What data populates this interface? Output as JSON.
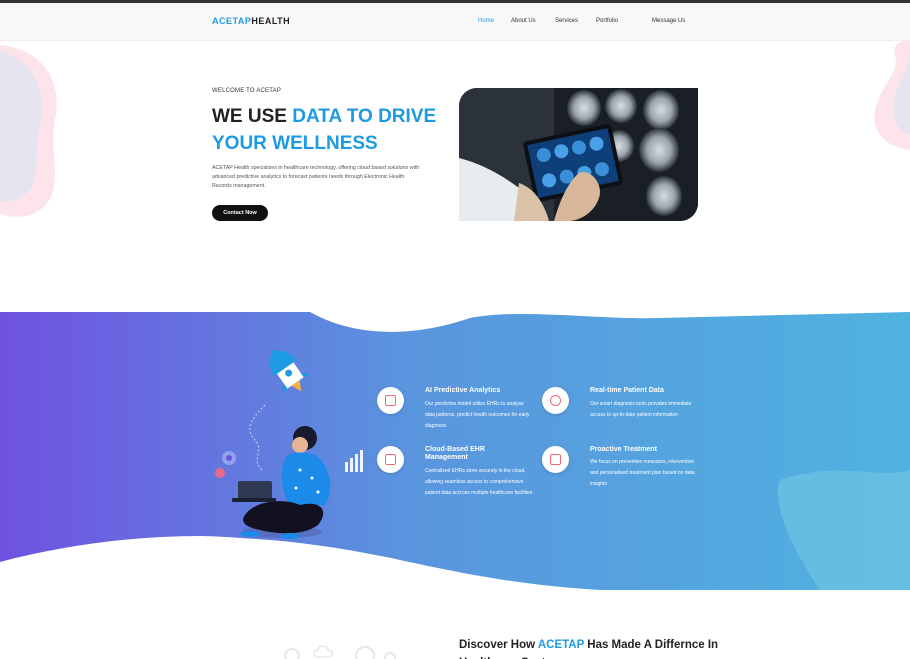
{
  "header": {
    "logo_part1": "ACETAP",
    "logo_part2": "HEALTH",
    "nav": [
      {
        "label": "Home"
      },
      {
        "label": "About Us"
      },
      {
        "label": "Services"
      },
      {
        "label": "Portfolio"
      },
      {
        "label": "Message Us"
      }
    ]
  },
  "hero": {
    "kicker": "WELCOME TO ACETAP",
    "title_plain": "WE USE ",
    "title_highlight": "DATA TO DRIVE YOUR WELLNESS",
    "desc_1": "ACETAP Health specializes in healthcare technology, offering ",
    "desc_italic": "cloud based solutions",
    "desc_2": " with advanced predictive analytics to forecast patients needs through Electronic Health Records management.",
    "cta": "Contact Now",
    "image_label": "Doctor viewing brain MRI scans on a tablet"
  },
  "features": [
    {
      "title": "AI Predictive Analytics",
      "desc": "Our predictive model utilize EHRs to analyse data patterns, predict health outcomes for early diagnosis",
      "icon": "monitor-icon"
    },
    {
      "title": "Real-time Patient Data",
      "desc": "Our smart diagnosis tools provides immediate access to up-to-date patient information",
      "icon": "search-data-icon"
    },
    {
      "title": "Cloud-Based EHR Management",
      "desc": "Centralized EHRs store securely in the cloud, allowing seamless access to comprehensive patient data accross multiple healthcare facilities",
      "icon": "cloud-records-icon"
    },
    {
      "title": "Proactive Treatment",
      "desc": "We focus on preventive measures, intervention and personalised treatment plan based on data insights",
      "icon": "treatment-plan-icon"
    }
  ],
  "discover": {
    "plain_1": "Discover How ",
    "highlight": "ACETAP",
    "plain_2": " Has Made A Differnce In Healthcare Sector"
  },
  "colors": {
    "accent": "#1c9be3",
    "band_left": "#6f52e0",
    "band_right": "#4fb3e0",
    "icon_pink": "#f06a7a"
  }
}
